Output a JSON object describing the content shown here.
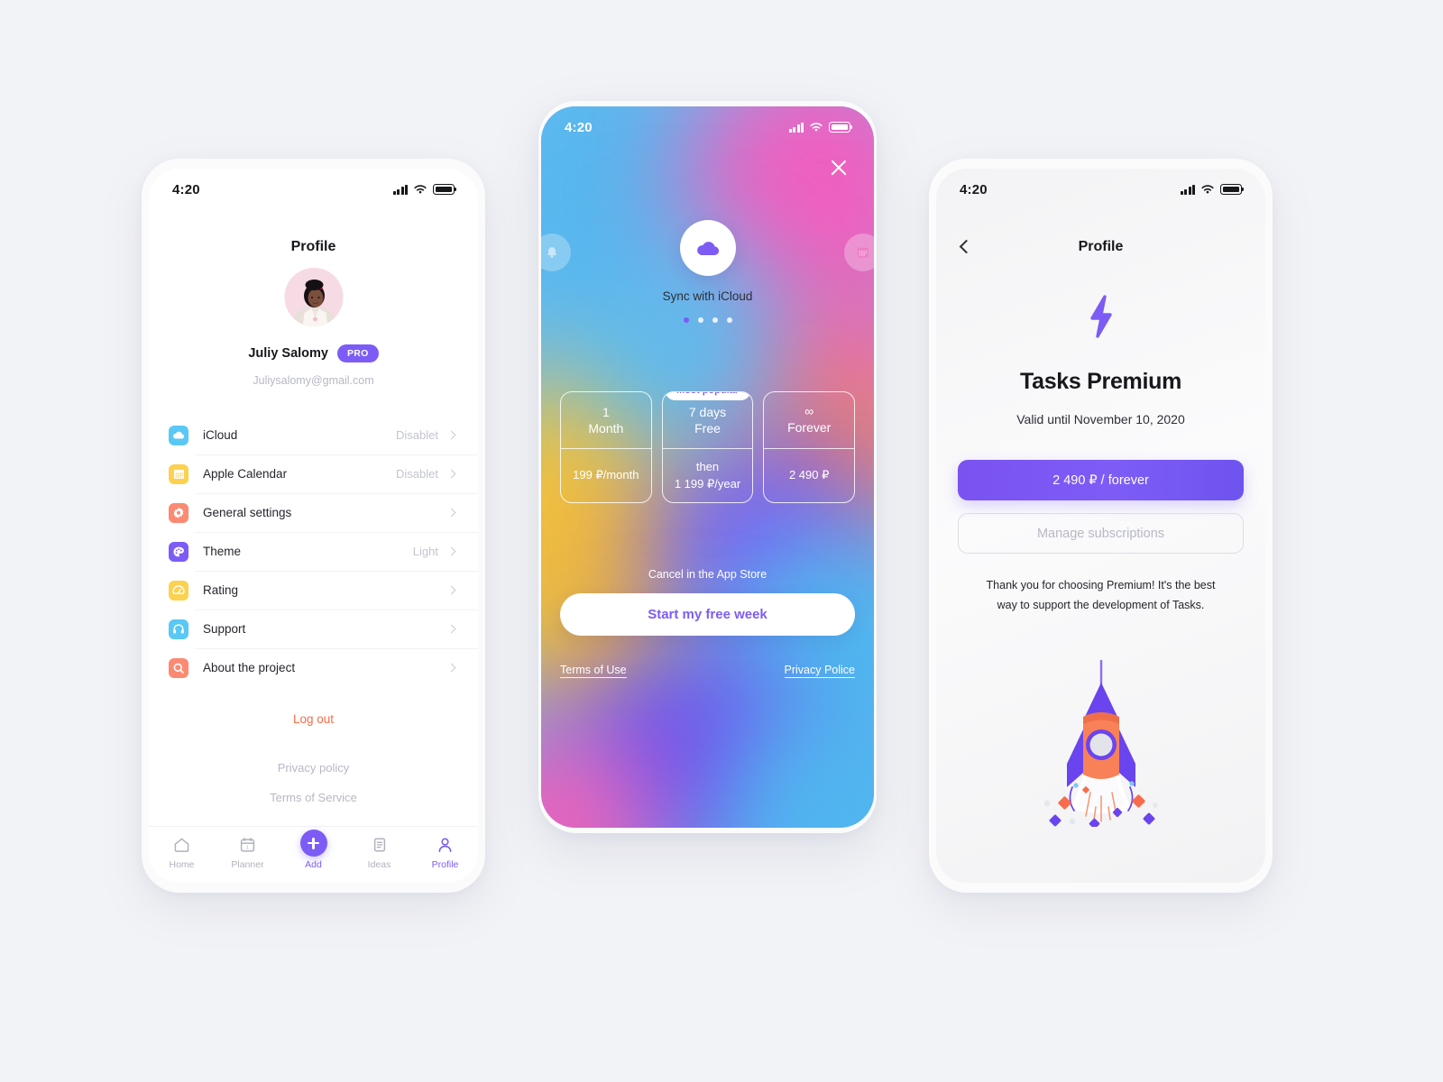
{
  "theme": {
    "purple": "#7c5cf5",
    "coral": "#fa6c47",
    "muted": "#b7b9c4",
    "ink": "#17181c",
    "page_bg": "#f2f3f6"
  },
  "profile_screen": {
    "status_bar": {
      "time": "4:20",
      "signal_icon": "cellular-bars-icon",
      "wifi_icon": "wifi-icon",
      "battery_icon": "battery-full-icon"
    },
    "title": "Profile",
    "avatar_alt": "avatar",
    "user_name": "Juliy Salomy",
    "pro_badge": "PRO",
    "email": "Juliysalomy@gmail.com",
    "settings": [
      {
        "icon": "icloud-icon",
        "label": "iCloud",
        "value": "Disablet",
        "color": "#5ac8f5"
      },
      {
        "icon": "calendar-icon",
        "label": "Apple Calendar",
        "value": "Disablet",
        "color": "#fcd14f"
      },
      {
        "icon": "gear-icon",
        "label": "General settings",
        "value": "",
        "color": "#fc8a72"
      },
      {
        "icon": "palette-icon",
        "label": "Theme",
        "value": "Light",
        "color": "#7c5cf5"
      },
      {
        "icon": "gauge-icon",
        "label": "Rating",
        "value": "",
        "color": "#fcd14f"
      },
      {
        "icon": "headphones-icon",
        "label": "Support",
        "value": "",
        "color": "#5ac8f5"
      },
      {
        "icon": "search-icon",
        "label": "About the project",
        "value": "",
        "color": "#fc8a72"
      }
    ],
    "log_out": "Log out",
    "privacy_policy": "Privacy policy",
    "terms_of_service": "Terms of Service",
    "tabs": [
      {
        "icon": "home-icon",
        "label": "Home",
        "active": false
      },
      {
        "icon": "calendar-planner-icon",
        "label": "Planner",
        "active": false
      },
      {
        "icon": "plus-icon",
        "label": "Add",
        "active": true
      },
      {
        "icon": "document-icon",
        "label": "Ideas",
        "active": false
      },
      {
        "icon": "person-icon",
        "label": "Profile",
        "active": true
      }
    ]
  },
  "paywall_screen": {
    "status_bar": {
      "time": "4:20",
      "signal_icon": "cellular-bars-icon",
      "wifi_icon": "wifi-icon",
      "battery_icon": "battery-full-icon"
    },
    "close_icon": "close-icon",
    "left_icon": "bell-icon",
    "right_icon": "calendar-icon",
    "hero_icon": "cloud-icon",
    "hero_label": "Sync with iCloud",
    "carousel_dots": 4,
    "carousel_active_index": 0,
    "plans": [
      {
        "top_line1": "1",
        "top_line2": "Month",
        "bottom_line1": "199 ₽/month",
        "bottom_line2": "",
        "badge": ""
      },
      {
        "top_line1": "7 days",
        "top_line2": "Free",
        "bottom_line1": "then",
        "bottom_line2": "1 199 ₽/year",
        "badge": "Most popular"
      },
      {
        "top_line1": "∞",
        "top_line2": "Forever",
        "bottom_line1": "2 490 ₽",
        "bottom_line2": "",
        "badge": ""
      }
    ],
    "cancel_note": "Cancel in the App Store",
    "cta_label": "Start my free week",
    "terms_link": "Terms of Use",
    "privacy_link": "Privacy Police"
  },
  "premium_screen": {
    "status_bar": {
      "time": "4:20",
      "signal_icon": "cellular-bars-icon",
      "wifi_icon": "wifi-icon",
      "battery_icon": "battery-full-icon"
    },
    "back_icon": "chevron-left-icon",
    "title": "Profile",
    "hero_icon": "lightning-bolt-icon",
    "heading": "Tasks Premium",
    "valid_until": "Valid until November 10, 2020",
    "buy_label": "2 490 ₽ / forever",
    "manage_label": "Manage subscriptions",
    "thanks_line1": "Thank you for choosing Premium!  It's the best",
    "thanks_line2": "way to support the development of Tasks.",
    "illustration": "rocket-illustration"
  }
}
